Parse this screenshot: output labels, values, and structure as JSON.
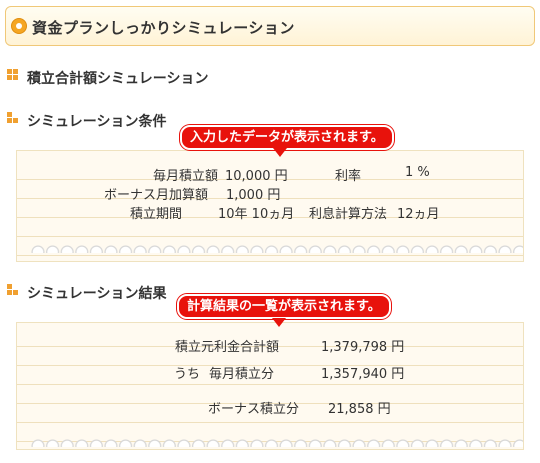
{
  "header": {
    "title": "資金プランしっかりシミュレーション"
  },
  "sections": {
    "main_title": "積立合計額シミュレーション",
    "conditions_title": "シミュレーション条件",
    "results_title": "シミュレーション結果"
  },
  "callouts": {
    "conditions": "入力したデータが表示されます。",
    "results": "計算結果の一覧が表示されます。"
  },
  "conditions": {
    "monthly_label": "毎月積立額",
    "monthly_value": "10,000 円",
    "rate_label": "利率",
    "rate_value": "1 %",
    "bonus_label": "ボーナス月加算額",
    "bonus_value": "1,000 円",
    "period_label": "積立期間",
    "period_value": "10年 10ヵ月",
    "interval_label": "利息計算方法",
    "interval_value": "12ヵ月"
  },
  "results": {
    "total_label": "積立元利金合計額",
    "total_value": "1,379,798 円",
    "of_which_label": "うち",
    "monthly_label": "毎月積立分",
    "monthly_value": "1,357,940 円",
    "bonus_label": "ボーナス積立分",
    "bonus_value": "21,858 円"
  },
  "colors": {
    "accent": "#f5a623",
    "callout": "#e8120c",
    "panel_bg": "#fffaf0",
    "section_icon": "#f0a030"
  }
}
